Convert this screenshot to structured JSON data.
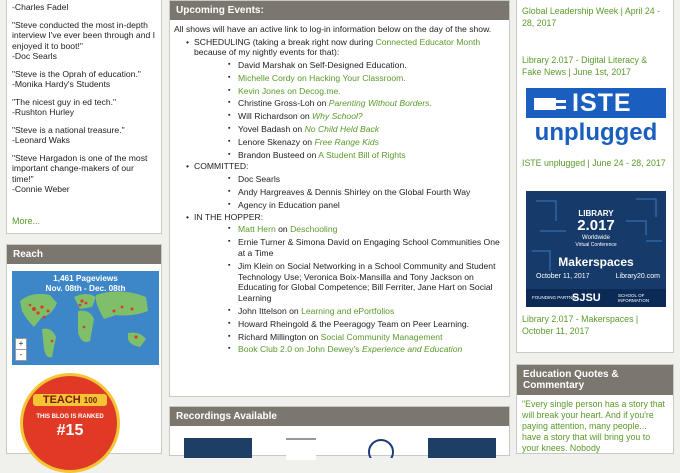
{
  "left": {
    "quotes": [
      {
        "text": "",
        "author": "-Charles Fadel"
      },
      {
        "text": "\"Steve conducted the most in-depth interview I've ever been through and I enjoyed it to boot!\"",
        "author": "-Doc Searls"
      },
      {
        "text": "\"Steve is the Oprah of education.\"",
        "author": "-Monika Hardy's Students"
      },
      {
        "text": "\"The nicest guy in ed tech.\"",
        "author": "-Rushton Hurley"
      },
      {
        "text": "\"Steve is a national treasure.\"",
        "author": "-Leonard Waks"
      },
      {
        "text": "\"Steve Hargadon is one of the most important change-makers of our time!\"",
        "author": "-Connie Weber"
      }
    ],
    "more": "More...",
    "reach_title": "Reach",
    "pageviews": "1,461 Pageviews",
    "date_range": "Nov. 08th - Dec. 08th",
    "zoom_in": "+",
    "zoom_out": "-",
    "badge_top": "TEACH",
    "badge_num": "100",
    "badge_text": "THIS BLOG IS RANKED",
    "badge_rank": "#15"
  },
  "center": {
    "events_title": "Upcoming Events:",
    "intro": "All shows will have an active link to log-in information below on the day of the show.",
    "scheduling_label": "SCHEDULING",
    "scheduling_note_a": " (taking a break right now during ",
    "scheduling_link": "Connected Educator Month",
    "scheduling_note_b": " because of my nightly events for that):",
    "scheduling": [
      {
        "name": "David Marshak",
        "conn": " on ",
        "topic": "Self-Designed Education.",
        "name_link": false,
        "topic_link": false,
        "italic": false
      },
      {
        "name": "Michelle Cordy on Hacking Your Classroom.",
        "conn": "",
        "topic": "",
        "name_link": true,
        "topic_link": false,
        "italic": false
      },
      {
        "name": "Kevin Jones on Decog.me.",
        "conn": "",
        "topic": "",
        "name_link": true,
        "topic_link": false,
        "italic": false
      },
      {
        "name": "Christine Gross-Loh",
        "conn": " on ",
        "topic": "Parenting Without Borders.",
        "name_link": false,
        "topic_link": true,
        "italic": true
      },
      {
        "name": "Will Richardson",
        "conn": "  on  ",
        "topic": "Why School?",
        "name_link": false,
        "topic_link": true,
        "italic": true
      },
      {
        "name": "Yovel Badash",
        "conn": " on ",
        "topic": "No Child Held Back",
        "name_link": false,
        "topic_link": true,
        "italic": true
      },
      {
        "name": "Lenore Skenazy",
        "conn": " on ",
        "topic": "Free Range Kids",
        "name_link": false,
        "topic_link": true,
        "italic": true
      },
      {
        "name": "Brandon Busteed",
        "conn": " on ",
        "topic": "A Student Bill of Rights",
        "name_link": false,
        "topic_link": true,
        "italic": false
      }
    ],
    "committed_label": "COMMITTED:",
    "committed": [
      {
        "name": "Doc Searls",
        "rest": ""
      },
      {
        "name": "Andy Hargreaves & Dennis Shirley",
        "rest": " on the Global Fourth Way"
      },
      {
        "name": "",
        "rest": "Agency in Education panel"
      }
    ],
    "hopper_label": "IN THE HOPPER:",
    "hopper": [
      {
        "name": "Matt Hern",
        "conn": "  on  ",
        "topic": "Deschooling",
        "name_link": true,
        "topic_link": true,
        "italic": false
      },
      {
        "name": "Ernie Turner & Simona David",
        "conn": " on Engaging School Communities One at a Time",
        "topic": "",
        "name_link": false,
        "topic_link": false,
        "italic": false
      },
      {
        "name": "Jim Klein",
        "conn": " on Social Networking in a School Community and Student Technology Use; Veronica Boix-Mansilla and Tony Jackson on Educating for Global Competence; Bill Ferriter, Jane Hart on Social Learning",
        "topic": "",
        "name_link": false,
        "topic_link": false,
        "italic": false
      },
      {
        "name": "John Ittelson",
        "conn": " on ",
        "topic": "Learning and ePortfolios",
        "name_link": false,
        "topic_link": true,
        "italic": false
      },
      {
        "name": "Howard Rheingold",
        "conn": "  & the Peeragogy Team on Peer Learning.",
        "topic": "",
        "name_link": false,
        "topic_link": false,
        "italic": false
      },
      {
        "name": "Richard Millington",
        "conn": "  on  ",
        "topic": "Social Community Management",
        "name_link": false,
        "topic_link": true,
        "italic": false
      },
      {
        "name": "Book Club 2.0 on  John Dewey's ",
        "conn": "",
        "topic": "Experience and Education",
        "name_link": true,
        "topic_link": true,
        "italic": true
      }
    ],
    "recordings_title": "Recordings Available"
  },
  "right": {
    "entries": [
      {
        "text": "Global Leadership Week  |  April 24 - 28, 2017"
      },
      {
        "text": "Library 2.017 - Digital Literacy & Fake News  |  June 1st, 2017"
      },
      {
        "text": "ISTE unplugged  |  June 24 - 28, 2017"
      },
      {
        "text": "Library 2.017 - Makerspaces  |  October 11, 2017"
      }
    ],
    "iste_logo": "ISTE",
    "iste_sub": "unplugged",
    "lib_title": "LIBRARY",
    "lib_num": "2.017",
    "lib_world": "Worldwide",
    "lib_conf": "Virtual Conference",
    "lib_topic": "Makerspaces",
    "lib_date": "October 11, 2017",
    "lib_site": "Library20.com",
    "lib_partner": "FOUNDING PARTNER",
    "lib_sjsu": "SJSU",
    "lib_school": "SCHOOL OF INFORMATION",
    "quotes_title": "Education Quotes & Commentary",
    "quote": "\"Every single person has a story that will break your heart. And if you're paying attention, many people... have a story that will bring you to your knees. Nobody"
  },
  "colors": {
    "link": "#5a9a2a",
    "header": "#7b776f",
    "map_ocean": "#3d86c8",
    "badge_red": "#e03a26",
    "iste_blue": "#1a5fbf"
  }
}
